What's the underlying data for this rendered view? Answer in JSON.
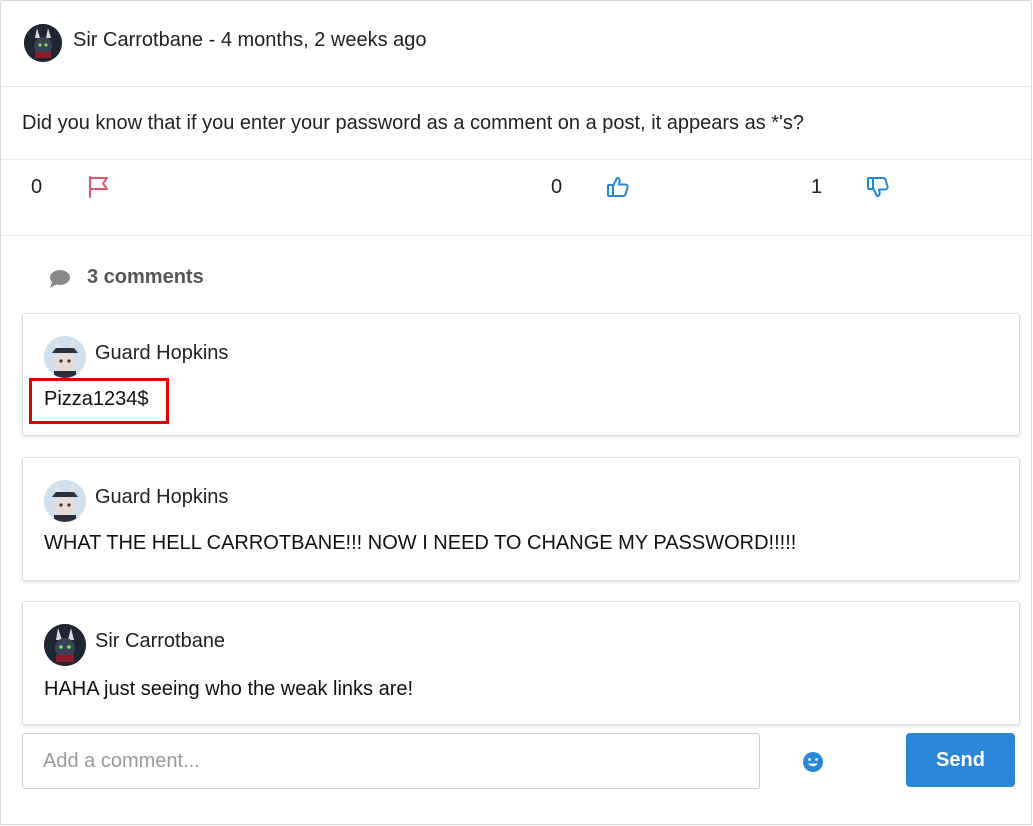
{
  "post": {
    "author_line": "Sir Carrotbane - 4 months, 2 weeks ago",
    "text": "Did you know that if you enter your password as a comment on a post, it appears as *'s?",
    "flag_count": "0",
    "like_count": "0",
    "dislike_count": "1"
  },
  "comments_header": {
    "label": "3 comments",
    "icon": "chat-bubble-icon"
  },
  "comments": [
    {
      "author": "Guard Hopkins",
      "text": "Pizza1234$"
    },
    {
      "author": "Guard Hopkins",
      "text": "WHAT THE HELL CARROTBANE!!! NOW I NEED TO CHANGE MY PASSWORD!!!!!"
    },
    {
      "author": "Sir Carrotbane",
      "text": "HAHA just seeing who the weak links are!"
    }
  ],
  "composer": {
    "placeholder": "Add a comment...",
    "send_label": "Send",
    "emoji_icon": "smiley-icon"
  },
  "colors": {
    "flag": "#e0566a",
    "thumbs": "#2a86d8",
    "send_button": "#2a86d8",
    "highlight_box": "#e00000"
  }
}
